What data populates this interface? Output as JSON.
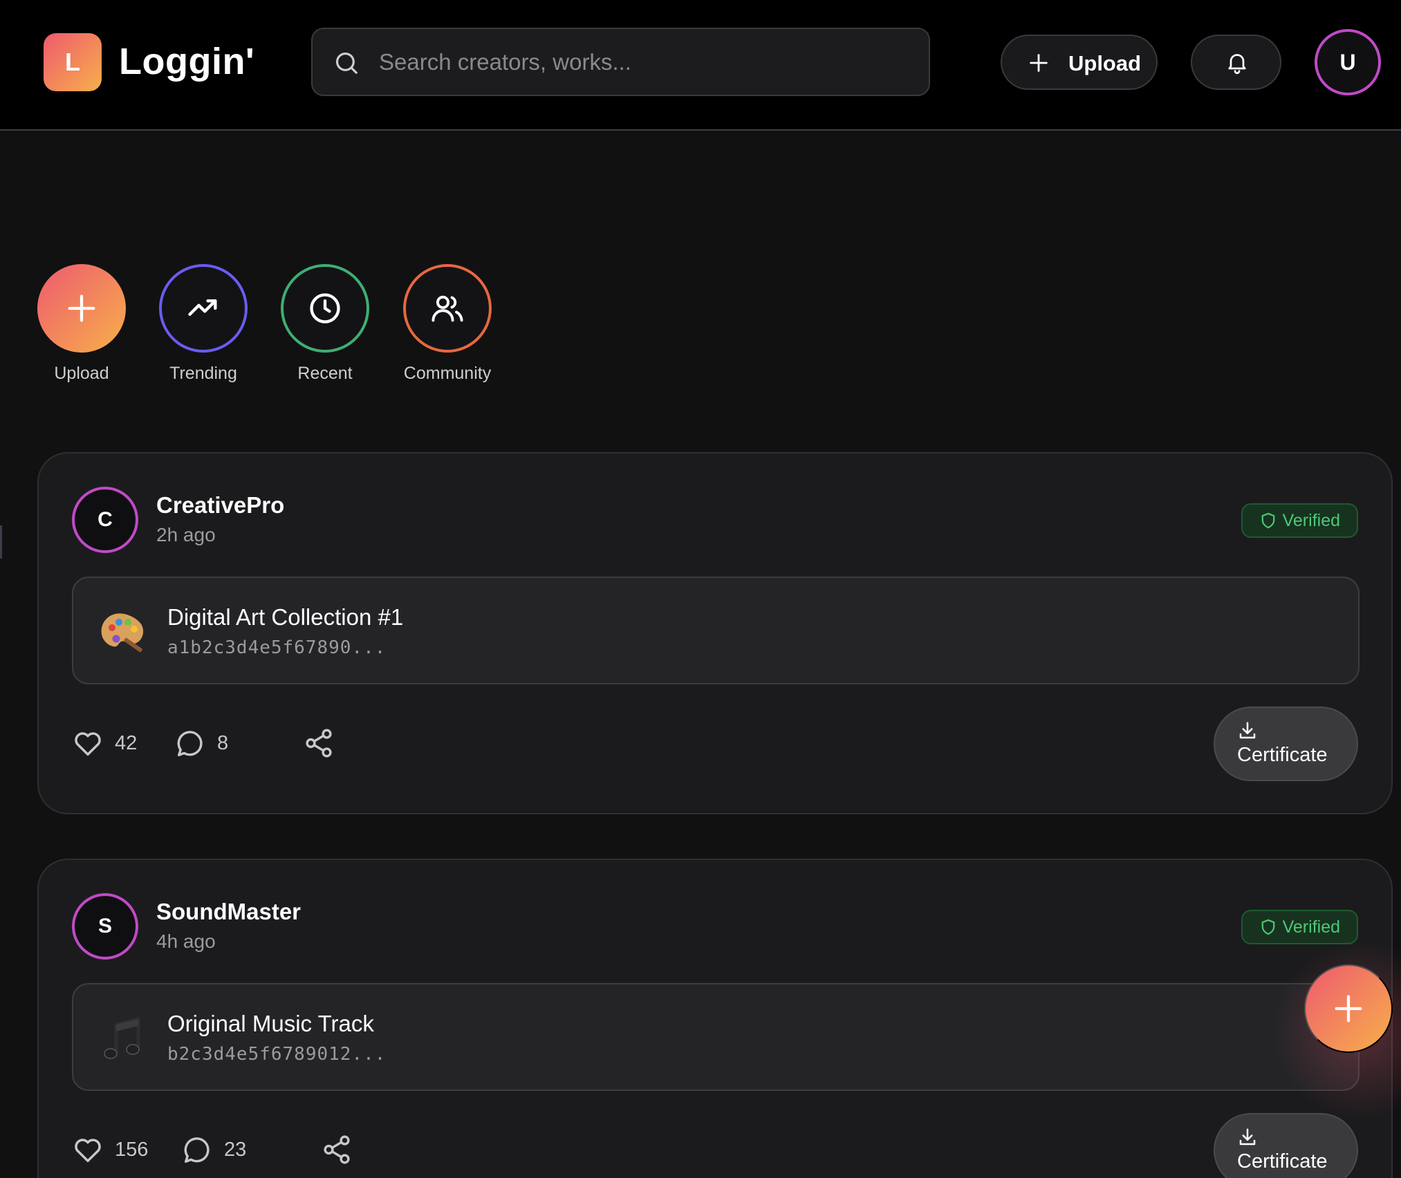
{
  "header": {
    "logo_letter": "L",
    "app_name": "Loggin'",
    "search_placeholder": "Search creators, works...",
    "upload_label": "Upload",
    "avatar_initial": "U"
  },
  "quick_actions": [
    {
      "label": "Upload",
      "icon": "plus-icon"
    },
    {
      "label": "Trending",
      "icon": "trending-up-icon"
    },
    {
      "label": "Recent",
      "icon": "clock-icon"
    },
    {
      "label": "Community",
      "icon": "users-icon"
    }
  ],
  "posts": [
    {
      "initial": "C",
      "author": "CreativePro",
      "time": "2h ago",
      "badge": "Verified",
      "work_icon": "palette-icon",
      "title": "Digital Art Collection #1",
      "hash": "a1b2c3d4e5f67890...",
      "likes": "42",
      "comments": "8",
      "certificate_label": "Certificate"
    },
    {
      "initial": "S",
      "author": "SoundMaster",
      "time": "4h ago",
      "badge": "Verified",
      "work_icon": "music-note-icon",
      "title": "Original Music Track",
      "hash": "b2c3d4e5f6789012...",
      "likes": "156",
      "comments": "23",
      "certificate_label": "Certificate"
    }
  ],
  "colors": {
    "accent_gradient_start": "#ee5a6f",
    "accent_gradient_end": "#f7b04a",
    "avatar_ring": "#c14ac6",
    "verified_green": "#4ec877",
    "trending_ring": "#6a5cf0",
    "recent_ring": "#3fae73",
    "community_ring": "#e5683f"
  }
}
